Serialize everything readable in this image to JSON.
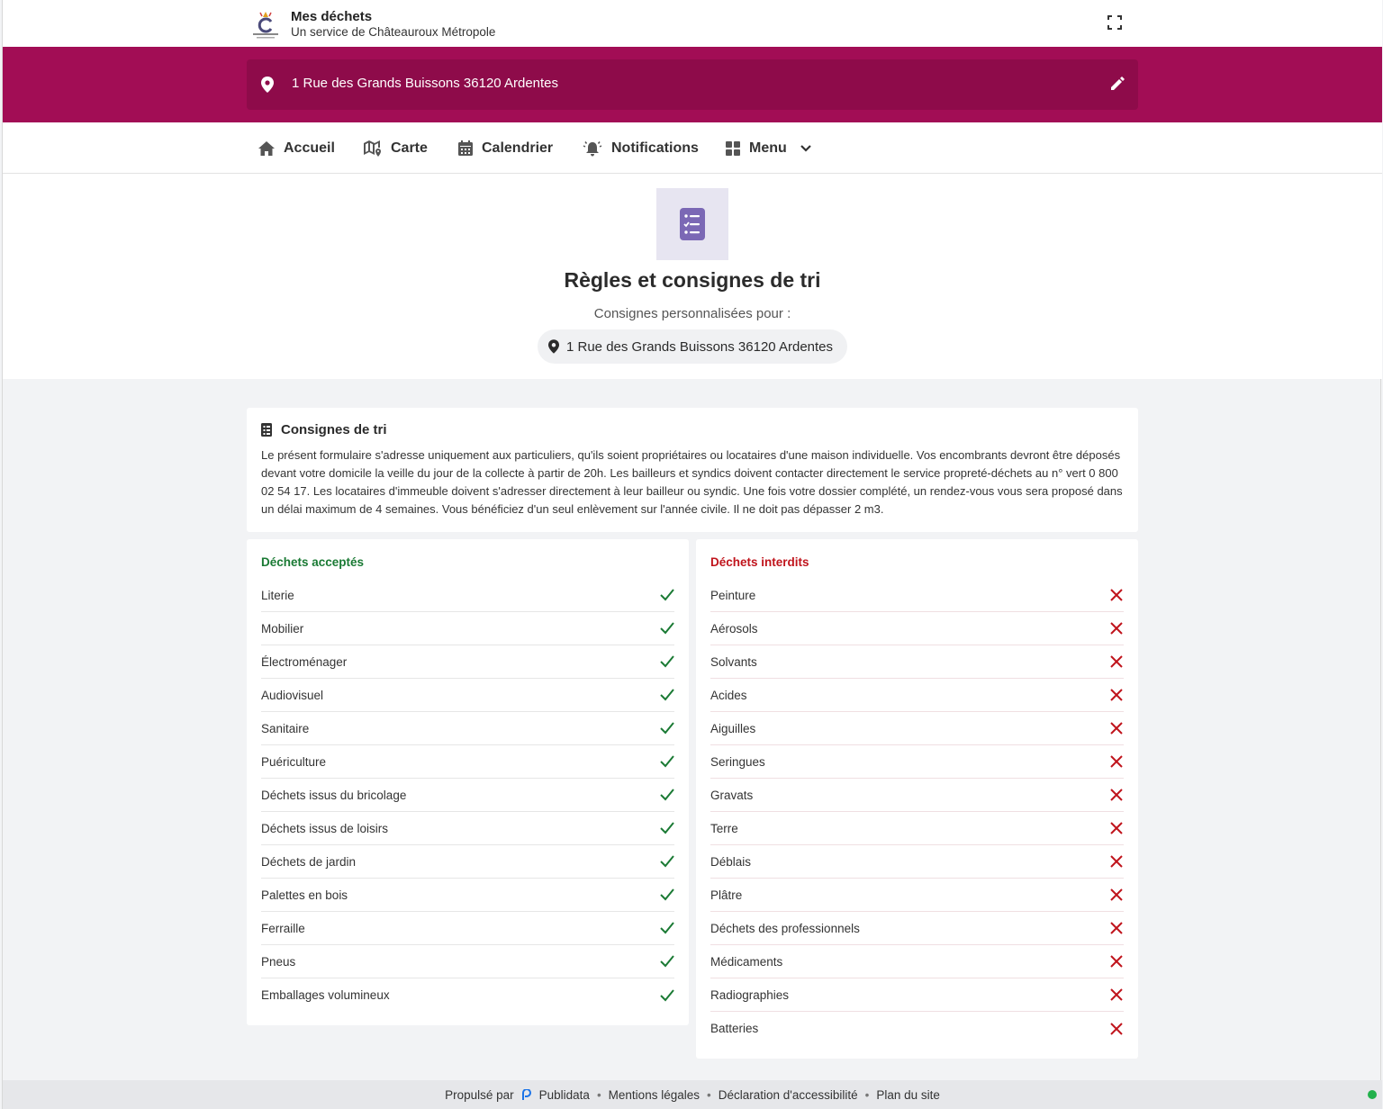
{
  "header": {
    "title": "Mes déchets",
    "subtitle": "Un service de Châteauroux Métropole"
  },
  "address": {
    "value": "1 Rue des Grands Buissons 36120 Ardentes"
  },
  "nav": {
    "items": [
      {
        "label": "Accueil",
        "icon": "home-icon"
      },
      {
        "label": "Carte",
        "icon": "map-icon"
      },
      {
        "label": "Calendrier",
        "icon": "calendar-icon"
      },
      {
        "label": "Notifications",
        "icon": "bell-icon"
      },
      {
        "label": "Menu",
        "icon": "grid-icon"
      }
    ]
  },
  "hero": {
    "title": "Règles et consignes de tri",
    "subtitle": "Consignes personnalisées pour :",
    "address": "1 Rue des Grands Buissons 36120 Ardentes"
  },
  "info": {
    "title": "Consignes de tri",
    "body": "Le présent formulaire s'adresse uniquement aux particuliers, qu'ils soient propriétaires ou locataires d'une maison individuelle. Vos encombrants devront être déposés devant votre domicile la veille du jour de la collecte à partir de 20h. Les bailleurs et syndics doivent contacter directement le service propreté-déchets au n° vert 0 800 02 54 17. Les locataires d'immeuble doivent s'adresser directement à leur bailleur ou syndic. Une fois votre dossier complété, un rendez-vous vous sera proposé dans un délai maximum de 4 semaines. Vous bénéficiez d'un seul enlèvement sur l'année civile. Il ne doit pas dépasser 2 m3."
  },
  "accepted": {
    "title": "Déchets acceptés",
    "color": "#1a7a34",
    "items": [
      "Literie",
      "Mobilier",
      "Électroménager",
      "Audiovisuel",
      "Sanitaire",
      "Puériculture",
      "Déchets issus du bricolage",
      "Déchets issus de loisirs",
      "Déchets de jardin",
      "Palettes en bois",
      "Ferraille",
      "Pneus",
      "Emballages volumineux"
    ]
  },
  "forbidden": {
    "title": "Déchets interdits",
    "color": "#c0141c",
    "items": [
      "Peinture",
      "Aérosols",
      "Solvants",
      "Acides",
      "Aiguilles",
      "Seringues",
      "Gravats",
      "Terre",
      "Déblais",
      "Plâtre",
      "Déchets des professionnels",
      "Médicaments",
      "Radiographies",
      "Batteries"
    ]
  },
  "footer": {
    "powered_by": "Propulsé par",
    "publidata": "Publidata",
    "legal": "Mentions légales",
    "accessibility": "Déclaration d'accessibilité",
    "sitemap": "Plan du site"
  },
  "colors": {
    "brand": "#a20d55",
    "brand_dark": "#8e0b4a",
    "hero_icon": "#7b68b5"
  }
}
